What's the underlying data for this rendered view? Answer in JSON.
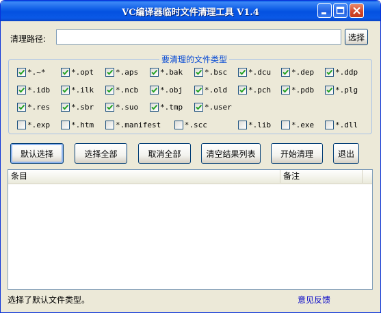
{
  "window": {
    "title": "VC编译器临时文件清理工具 V1.4"
  },
  "path": {
    "label": "清理路径:",
    "value": "",
    "browse_label": "选择"
  },
  "filetypes": {
    "group_title": "要清理的文件类型",
    "items": [
      {
        "label": "*.~*",
        "checked": true
      },
      {
        "label": "*.opt",
        "checked": true
      },
      {
        "label": "*.aps",
        "checked": true
      },
      {
        "label": "*.bak",
        "checked": true
      },
      {
        "label": "*.bsc",
        "checked": true
      },
      {
        "label": "*.dcu",
        "checked": true
      },
      {
        "label": "*.dep",
        "checked": true
      },
      {
        "label": "*.ddp",
        "checked": true
      },
      {
        "label": "*.idb",
        "checked": true
      },
      {
        "label": "*.ilk",
        "checked": true
      },
      {
        "label": "*.ncb",
        "checked": true
      },
      {
        "label": "*.obj",
        "checked": true
      },
      {
        "label": "*.old",
        "checked": true
      },
      {
        "label": "*.pch",
        "checked": true
      },
      {
        "label": "*.pdb",
        "checked": true
      },
      {
        "label": "*.plg",
        "checked": true
      },
      {
        "label": "*.res",
        "checked": true
      },
      {
        "label": "*.sbr",
        "checked": true
      },
      {
        "label": "*.suo",
        "checked": true
      },
      {
        "label": "*.tmp",
        "checked": true
      },
      {
        "label": "*.user",
        "checked": true
      },
      {
        "label": "*.exp",
        "checked": false
      },
      {
        "label": "*.htm",
        "checked": false
      },
      {
        "label": "*.manifest",
        "checked": false
      },
      {
        "label": "*.scc",
        "checked": false
      },
      {
        "label": "*.lib",
        "checked": false
      },
      {
        "label": "*.exe",
        "checked": false
      },
      {
        "label": "*.dll",
        "checked": false
      }
    ]
  },
  "actions": {
    "default_select": "默认选择",
    "select_all": "选择全部",
    "deselect_all": "取消全部",
    "clear_list": "清空结果列表",
    "start_clean": "开始清理",
    "exit": "退出"
  },
  "results": {
    "col_item": "条目",
    "col_note": "备注"
  },
  "status": {
    "text": "选择了默认文件类型。",
    "feedback_link": "意见反馈"
  },
  "colors": {
    "accent": "#0046d5",
    "checkmark": "#21a121",
    "title_bar": "#0b5ae5"
  }
}
